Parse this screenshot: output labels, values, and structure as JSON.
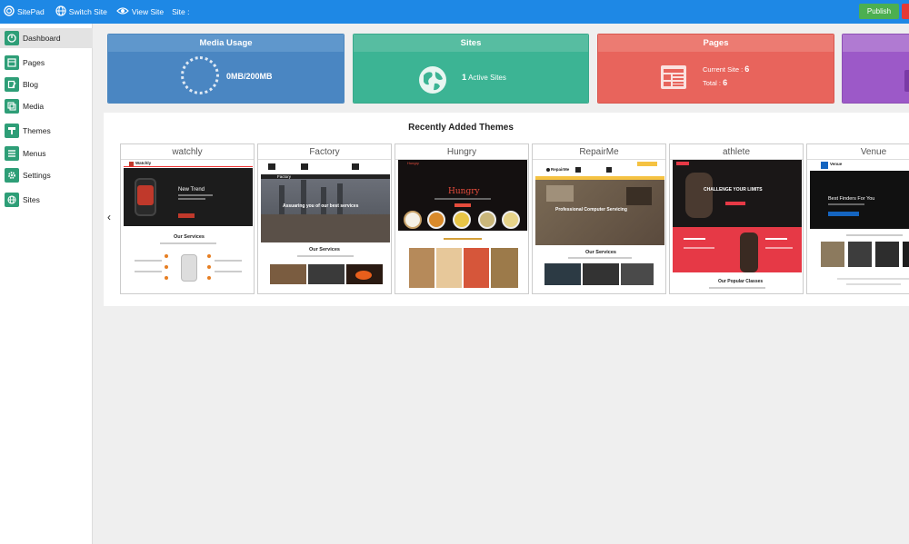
{
  "topbar": {
    "logo_label": "SitePad",
    "switch_label": "Switch Site",
    "view_label": "View Site",
    "site_label": "Site :",
    "publish_label": "Publish"
  },
  "sidebar": {
    "items": [
      {
        "label": "Dashboard",
        "icon": "dashboard-icon"
      },
      {
        "label": "Pages",
        "icon": "pages-icon"
      },
      {
        "label": "Blog",
        "icon": "blog-icon"
      },
      {
        "label": "Media",
        "icon": "media-icon"
      },
      {
        "label": "Themes",
        "icon": "themes-icon"
      },
      {
        "label": "Menus",
        "icon": "menus-icon"
      },
      {
        "label": "Settings",
        "icon": "settings-gear-icon"
      },
      {
        "label": "Sites",
        "icon": "globe-icon"
      }
    ]
  },
  "cards": {
    "media": {
      "title": "Media Usage",
      "value": "0MB/200MB"
    },
    "sites": {
      "title": "Sites",
      "count": "1",
      "suffix": "Active Sites"
    },
    "pages": {
      "title": "Pages",
      "current_label": "Current Site :",
      "current_value": "6",
      "total_label": "Total :",
      "total_value": "6"
    }
  },
  "themes": {
    "title": "Recently Added Themes",
    "items": [
      {
        "name": "watchly",
        "logo": "Watchly",
        "headline": "New Trend",
        "sub": "Our Services"
      },
      {
        "name": "Factory",
        "logo": "Factory",
        "headline": "Assuaring you of our best services",
        "sub": "Our Services"
      },
      {
        "name": "Hungry",
        "logo": "Hungry",
        "headline": "Hungry",
        "sub": ""
      },
      {
        "name": "RepairMe",
        "logo": "RepairMe",
        "headline": "Professional Computer Servicing",
        "sub": "Our Services"
      },
      {
        "name": "athlete",
        "logo": "",
        "headline": "CHALLENGE YOUR LIMITS",
        "sub": "Our Popular Classes"
      },
      {
        "name": "Venue",
        "logo": "Venue",
        "headline": "Best Finders For You",
        "sub": ""
      }
    ]
  },
  "colors": {
    "topbar": "#1e88e5",
    "media": "#4a86c2",
    "sites": "#3cb494",
    "pages": "#e8645c",
    "extra": "#9c59c8",
    "publish": "#4caf50"
  }
}
